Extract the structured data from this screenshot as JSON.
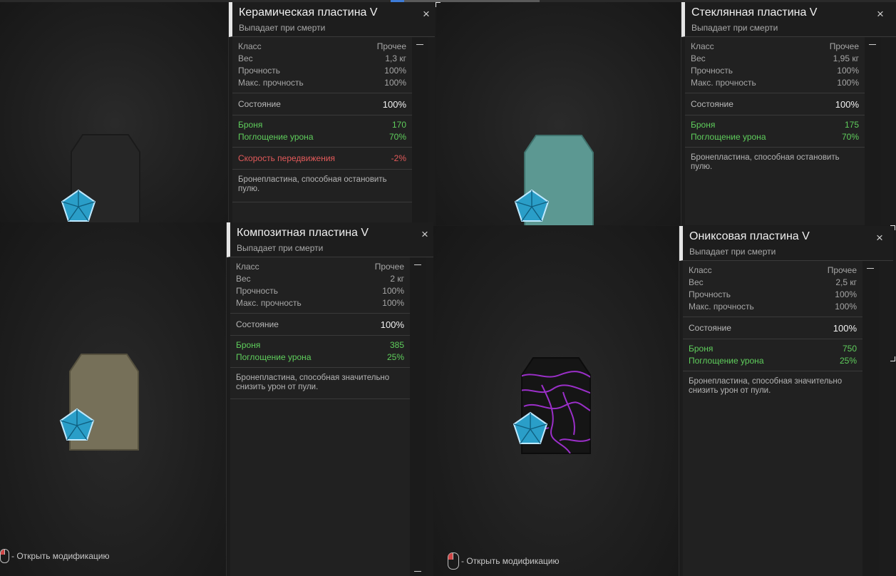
{
  "accent_colors": {
    "green": "#5fce5c",
    "red": "#e35a5a",
    "badge": "#2a9ec8"
  },
  "open_mod_hint": "- Открыть модификацию",
  "cards": [
    {
      "title": "Керамическая пластина V",
      "subtitle": "Выпадает при смерти",
      "close_icon": "×",
      "stats": [
        {
          "k": "Класс",
          "v": "Прочее"
        },
        {
          "k": "Вес",
          "v": "1,3 кг"
        },
        {
          "k": "Прочность",
          "v": "100%"
        },
        {
          "k": "Макс. прочность",
          "v": "100%"
        }
      ],
      "state": {
        "k": "Состояние",
        "v": "100%"
      },
      "armor": [
        {
          "k": "Броня",
          "v": "170"
        },
        {
          "k": "Поглощение урона",
          "v": "70%"
        }
      ],
      "penalty": {
        "k": "Скорость передвижения",
        "v": "-2%"
      },
      "description": "Бронепластина, способная остановить пулю.",
      "plate_color": "#262626"
    },
    {
      "title": "Стеклянная пластина V",
      "subtitle": "Выпадает при смерти",
      "close_icon": "×",
      "stats": [
        {
          "k": "Класс",
          "v": "Прочее"
        },
        {
          "k": "Вес",
          "v": "1,95 кг"
        },
        {
          "k": "Прочность",
          "v": "100%"
        },
        {
          "k": "Макс. прочность",
          "v": "100%"
        }
      ],
      "state": {
        "k": "Состояние",
        "v": "100%"
      },
      "armor": [
        {
          "k": "Броня",
          "v": "175"
        },
        {
          "k": "Поглощение урона",
          "v": "70%"
        }
      ],
      "description": "Бронепластина, способная остановить пулю.",
      "plate_color": "#5c9892"
    },
    {
      "title": "Композитная пластина V",
      "subtitle": "Выпадает при смерти",
      "close_icon": "×",
      "stats": [
        {
          "k": "Класс",
          "v": "Прочее"
        },
        {
          "k": "Вес",
          "v": "2 кг"
        },
        {
          "k": "Прочность",
          "v": "100%"
        },
        {
          "k": "Макс. прочность",
          "v": "100%"
        }
      ],
      "state": {
        "k": "Состояние",
        "v": "100%"
      },
      "armor": [
        {
          "k": "Броня",
          "v": "385"
        },
        {
          "k": "Поглощение урона",
          "v": "25%"
        }
      ],
      "description": "Бронепластина, способная значительно снизить урон от пули.",
      "plate_color": "#767059"
    },
    {
      "title": "Ониксовая пластина V",
      "subtitle": "Выпадает при смерти",
      "close_icon": "×",
      "stats": [
        {
          "k": "Класс",
          "v": "Прочее"
        },
        {
          "k": "Вес",
          "v": "2,5 кг"
        },
        {
          "k": "Прочность",
          "v": "100%"
        },
        {
          "k": "Макс. прочность",
          "v": "100%"
        }
      ],
      "state": {
        "k": "Состояние",
        "v": "100%"
      },
      "armor": [
        {
          "k": "Броня",
          "v": "750"
        },
        {
          "k": "Поглощение урона",
          "v": "25%"
        }
      ],
      "description": "Бронепластина, способная значительно снизить урон от пули.",
      "plate_color": "#151515"
    }
  ]
}
